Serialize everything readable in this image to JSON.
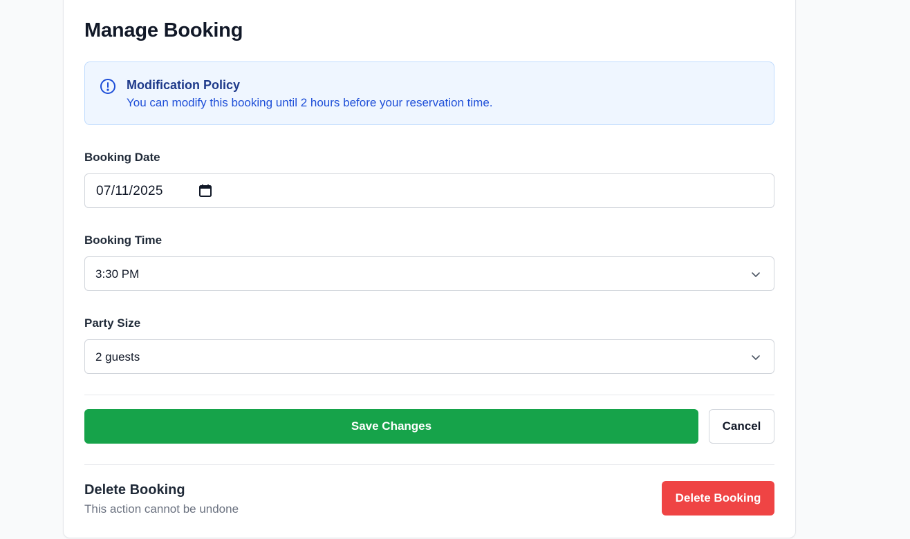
{
  "page": {
    "title": "Manage Booking"
  },
  "policy": {
    "icon": "info-circle-icon",
    "title": "Modification Policy",
    "text": "You can modify this booking until 2 hours before your reservation time."
  },
  "form": {
    "date": {
      "label": "Booking Date",
      "value": "07/11/2025",
      "icon": "calendar-icon"
    },
    "time": {
      "label": "Booking Time",
      "value": "3:30 PM",
      "icon": "chevron-down-icon"
    },
    "party": {
      "label": "Party Size",
      "value": "2 guests",
      "icon": "chevron-down-icon"
    }
  },
  "actions": {
    "save_label": "Save Changes",
    "cancel_label": "Cancel"
  },
  "danger": {
    "title": "Delete Booking",
    "subtitle": "This action cannot be undone",
    "button_label": "Delete Booking"
  },
  "colors": {
    "primary_green": "#16a34a",
    "danger_red": "#ef4444",
    "info_bg": "#eff6ff",
    "info_text": "#1d4ed8"
  }
}
